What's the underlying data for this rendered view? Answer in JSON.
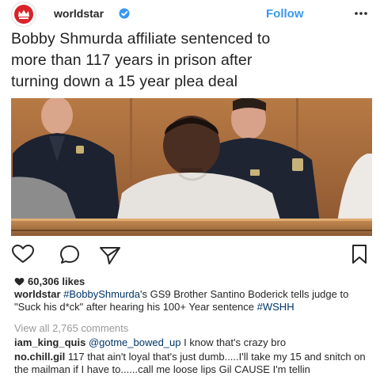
{
  "post": {
    "username": "worldstar",
    "follow_label": "Follow",
    "headline_lines": [
      "Bobby Shmurda affiliate sentenced to",
      "more than 117 years in prison after",
      "turning down a 15 year plea deal"
    ],
    "likes": "60,306 likes",
    "caption": {
      "user": "worldstar",
      "hashtag1": "#BobbyShmurda",
      "text": "'s GS9 Brother Santino Boderick tells judge to \"Suck his d*ck\" after hearing his 100+ Year sentence",
      "hashtag2": "#WSHH"
    },
    "view_all": "View all 2,765 comments",
    "comments": [
      {
        "user": "iam_king_quis",
        "mention": "@gotme_bowed_up",
        "text": "I know that's crazy bro"
      },
      {
        "user": "no.chill.gil",
        "text": "117 that ain't loyal that's just dumb.....I'll take my 15 and snitch on the mailman if I have to......call me loose lips Gil CAUSE I'm tellin"
      }
    ]
  },
  "colors": {
    "accent": "#3897f0",
    "brand_red": "#d8232a",
    "hashtag": "#003569",
    "muted": "#999999",
    "text": "#262626"
  },
  "icons": {
    "avatar": "worldstar-crown-logo",
    "verified": "verified-badge-icon",
    "more": "more-options-icon",
    "like": "heart-outline-icon",
    "comment": "comment-bubble-icon",
    "share": "paper-plane-icon",
    "save": "bookmark-icon",
    "likes": "heart-filled-icon"
  }
}
